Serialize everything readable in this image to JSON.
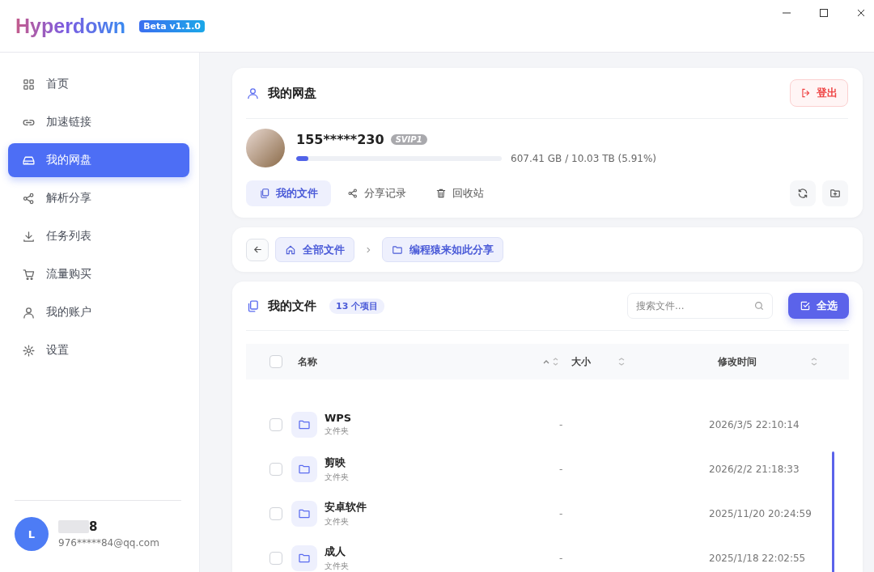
{
  "app": {
    "name": "Hyperdown",
    "version": "Beta v1.1.0"
  },
  "sidebar": {
    "items": [
      {
        "label": "首页",
        "kind": "grid",
        "selected": false
      },
      {
        "label": "加速链接",
        "kind": "link",
        "selected": false
      },
      {
        "label": "我的网盘",
        "kind": "drive",
        "selected": true
      },
      {
        "label": "解析分享",
        "kind": "share",
        "selected": false
      },
      {
        "label": "任务列表",
        "kind": "download",
        "selected": false
      },
      {
        "label": "流量购买",
        "kind": "cart",
        "selected": false
      },
      {
        "label": "我的账户",
        "kind": "user",
        "selected": false
      },
      {
        "label": "设置",
        "kind": "gear",
        "selected": false
      }
    ],
    "user": {
      "initial": "L",
      "name": "8",
      "email": "976*****84@qq.com"
    }
  },
  "drive": {
    "title": "我的网盘",
    "logout": "登出",
    "account": "155*****230",
    "vip_badge": "SVIP1",
    "level": 0.0591,
    "usage": "607.41 GB / 10.03 TB (5.91%)",
    "tabs": [
      {
        "label": "我的文件",
        "kind": "files",
        "selected": true
      },
      {
        "label": "分享记录",
        "kind": "share",
        "selected": false
      },
      {
        "label": "回收站",
        "kind": "trash",
        "selected": false
      }
    ]
  },
  "breadcrumb": [
    {
      "label": "全部文件",
      "kind": "home"
    },
    {
      "label": "编程猿来如此分享",
      "kind": "folder"
    }
  ],
  "files": {
    "title": "我的文件",
    "count": "13 个项目",
    "search": {
      "placeholder": "搜索文件..."
    },
    "select_all": "全选",
    "all_checked": false,
    "columns": [
      "名称",
      "大小",
      "修改时间"
    ],
    "rows": [
      {
        "name": "WPS",
        "type": "文件夹",
        "size": "-",
        "modified": "2026/3/5 22:10:14",
        "checked": false
      },
      {
        "name": "剪映",
        "type": "文件夹",
        "size": "-",
        "modified": "2026/2/2 21:18:33",
        "checked": false
      },
      {
        "name": "安卓软件",
        "type": "文件夹",
        "size": "-",
        "modified": "2025/11/20 20:24:59",
        "checked": false
      },
      {
        "name": "成人",
        "type": "文件夹",
        "size": "-",
        "modified": "2025/1/18 22:02:55",
        "checked": false
      }
    ]
  }
}
